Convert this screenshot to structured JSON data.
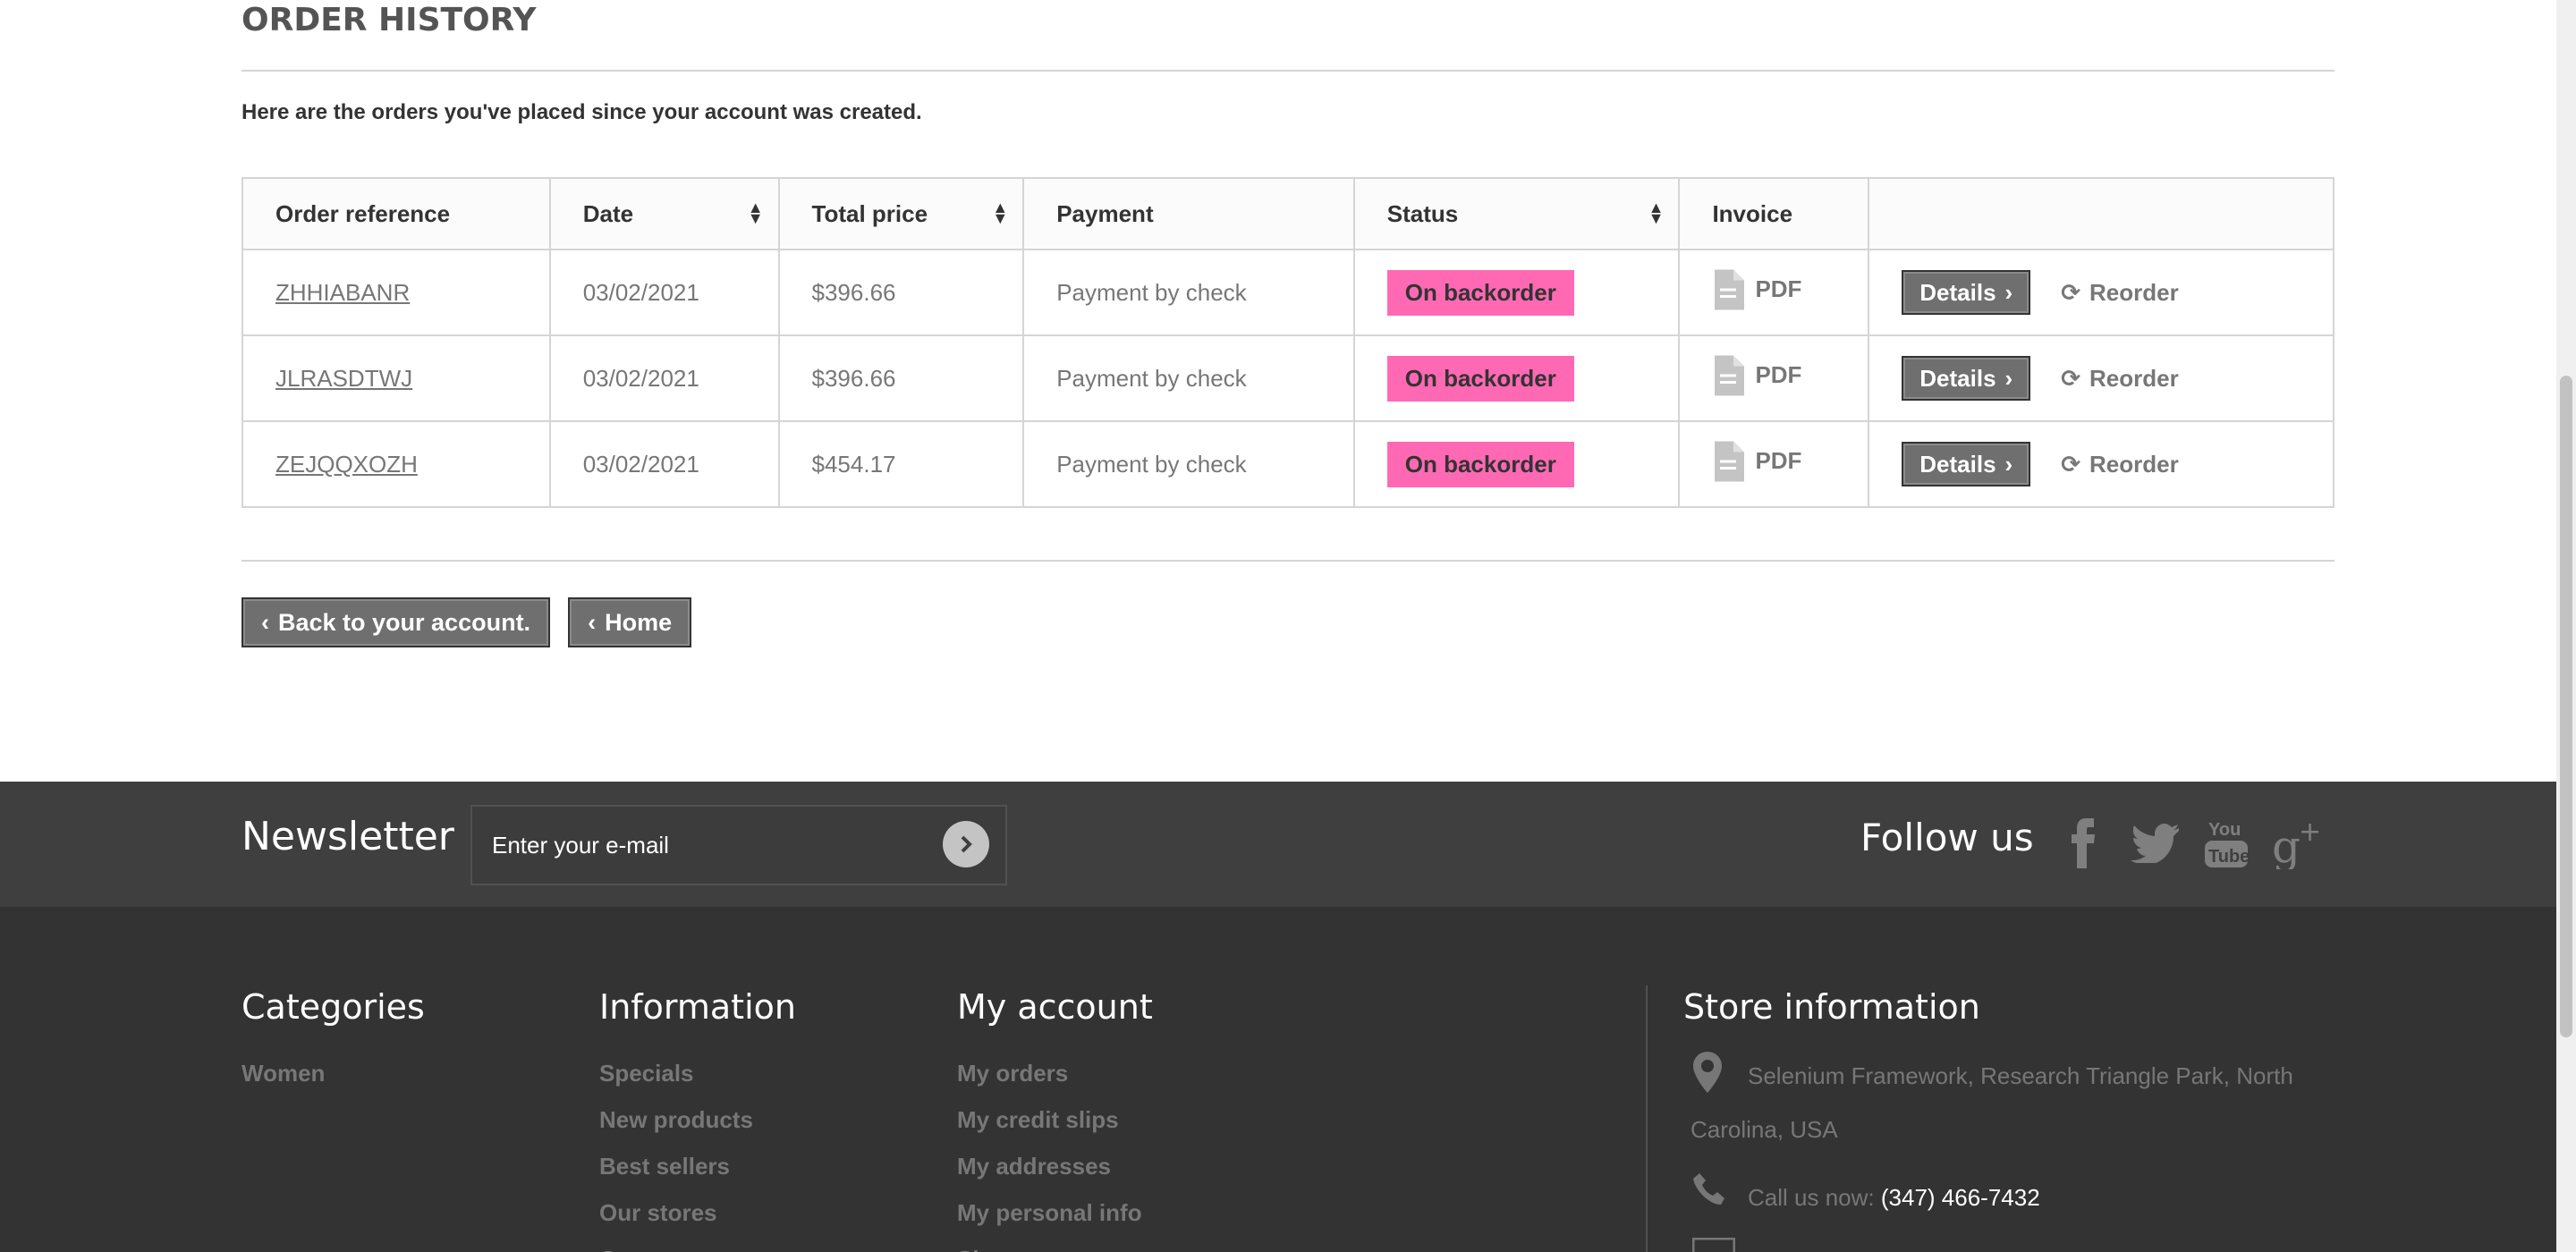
{
  "page": {
    "title": "ORDER HISTORY",
    "intro": "Here are the orders you've placed since your account was created."
  },
  "table": {
    "headers": {
      "order_reference": "Order reference",
      "date": "Date",
      "total_price": "Total price",
      "payment": "Payment",
      "status": "Status",
      "invoice": "Invoice",
      "actions": ""
    },
    "rows": [
      {
        "reference": "ZHHIABANR",
        "date": "03/02/2021",
        "total": "$396.66",
        "payment": "Payment by check",
        "status": "On backorder",
        "invoice": "PDF",
        "details": "Details",
        "reorder": "Reorder"
      },
      {
        "reference": "JLRASDTWJ",
        "date": "03/02/2021",
        "total": "$396.66",
        "payment": "Payment by check",
        "status": "On backorder",
        "invoice": "PDF",
        "details": "Details",
        "reorder": "Reorder"
      },
      {
        "reference": "ZEJQQXOZH",
        "date": "03/02/2021",
        "total": "$454.17",
        "payment": "Payment by check",
        "status": "On backorder",
        "invoice": "PDF",
        "details": "Details",
        "reorder": "Reorder"
      }
    ]
  },
  "navigation": {
    "back_label": "Back to your account.",
    "home_label": "Home"
  },
  "newsletter": {
    "title": "Newsletter",
    "placeholder": "Enter your e-mail",
    "follow_title": "Follow us",
    "social": [
      "facebook-icon",
      "twitter-icon",
      "youtube-icon",
      "google-plus-icon"
    ]
  },
  "footer": {
    "categories": {
      "title": "Categories",
      "items": [
        "Women"
      ]
    },
    "information": {
      "title": "Information",
      "items": [
        "Specials",
        "New products",
        "Best sellers",
        "Our stores",
        "Contact us"
      ]
    },
    "my_account": {
      "title": "My account",
      "items": [
        "My orders",
        "My credit slips",
        "My addresses",
        "My personal info",
        "Sign out"
      ]
    },
    "store": {
      "title": "Store information",
      "address_line1": "Selenium Framework, Research Triangle Park, North",
      "address_line2": "Carolina, USA",
      "call_label": "Call us now:",
      "phone": "(347) 466-7432"
    }
  },
  "colors": {
    "status_badge": "#ff69b4",
    "button_dark": "#6f6f6f",
    "newsletter_band": "#3f3f3f",
    "footer_bg": "#333333"
  }
}
